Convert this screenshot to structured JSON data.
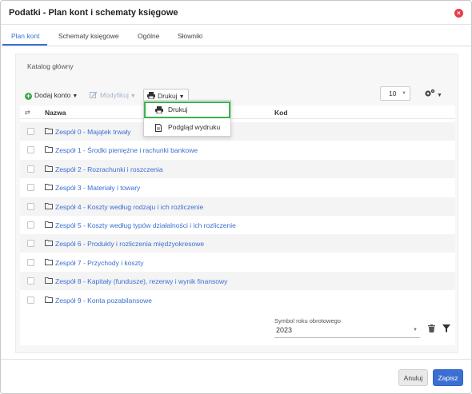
{
  "window": {
    "title": "Podatki - Plan kont i schematy księgowe"
  },
  "tabs": [
    {
      "label": "Plan kont"
    },
    {
      "label": "Schematy księgowe"
    },
    {
      "label": "Ogólne"
    },
    {
      "label": "Słowniki"
    }
  ],
  "breadcrumb": "Katalog główny",
  "toolbar": {
    "add_label": "Dodaj konto",
    "modify_label": "Modyfikuj",
    "print_label": "Drukuj",
    "page_size": "10"
  },
  "print_menu": [
    {
      "label": "Drukuj"
    },
    {
      "label": "Podgląd wydruku"
    }
  ],
  "grid": {
    "columns": {
      "name": "Nazwa",
      "code": "Kod"
    },
    "rows": [
      {
        "name": "Zespół 0 - Majątek trwały",
        "code": ""
      },
      {
        "name": "Zespół 1 - Środki pieniężne i rachunki bankowe",
        "code": ""
      },
      {
        "name": "Zespół 2 - Rozrachunki i roszczenia",
        "code": ""
      },
      {
        "name": "Zespół 3 - Materiały i towary",
        "code": ""
      },
      {
        "name": "Zespół 4 - Koszty według rodzaju i ich rozliczenie",
        "code": ""
      },
      {
        "name": "Zespół 5 - Koszty według typów działalności i ich rozliczenie",
        "code": ""
      },
      {
        "name": "Zespół 6 - Produkty i rozliczenia międzyokresowe",
        "code": ""
      },
      {
        "name": "Zespół 7 - Przychody i koszty",
        "code": ""
      },
      {
        "name": "Zespół 8 - Kapitały (fundusze), rezerwy i wynik finansowy",
        "code": ""
      },
      {
        "name": "Zespół 9 - Konta pozabilansowe",
        "code": ""
      }
    ]
  },
  "year": {
    "label": "Symbol roku obrotowego",
    "value": "2023"
  },
  "footer": {
    "cancel_label": "Anuluj",
    "save_label": "Zapisz"
  },
  "colors": {
    "accent": "#3b6fd1",
    "close": "#e53b4a",
    "add": "#3ca84a",
    "highlight": "#3bb34a"
  }
}
